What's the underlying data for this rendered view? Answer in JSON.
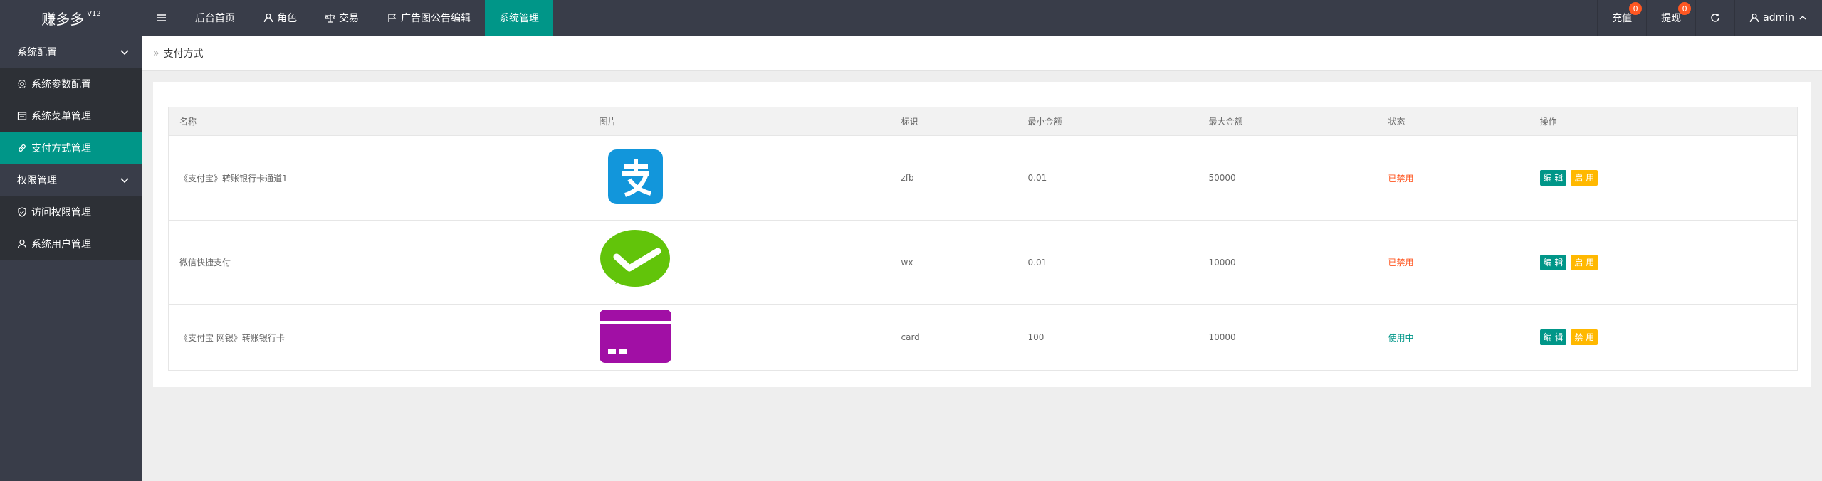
{
  "header": {
    "logo": "赚多多",
    "version": "V12",
    "nav": [
      {
        "label": "",
        "icon": "menu-icon"
      },
      {
        "label": "后台首页"
      },
      {
        "label": "角色",
        "icon": "user-icon"
      },
      {
        "label": "交易",
        "icon": "scale-icon"
      },
      {
        "label": "广告图公告编辑",
        "icon": "flag-icon"
      },
      {
        "label": "系统管理",
        "active": true
      }
    ],
    "right": {
      "recharge_label": "充值",
      "recharge_count": "0",
      "withdraw_label": "提现",
      "withdraw_count": "0",
      "user_label": "admin"
    }
  },
  "sidebar": {
    "groups": [
      {
        "label": "系统配置",
        "items": [
          {
            "label": "系统参数配置",
            "icon": "gear-icon"
          },
          {
            "label": "系统菜单管理",
            "icon": "list-icon"
          },
          {
            "label": "支付方式管理",
            "icon": "link-icon",
            "active": true
          }
        ]
      },
      {
        "label": "权限管理",
        "items": [
          {
            "label": "访问权限管理",
            "icon": "shield-icon"
          },
          {
            "label": "系统用户管理",
            "icon": "user-icon"
          }
        ]
      }
    ]
  },
  "breadcrumb": {
    "current": "支付方式"
  },
  "table": {
    "headers": [
      "名称",
      "图片",
      "标识",
      "最小金额",
      "最大金额",
      "状态",
      "操作"
    ],
    "rows": [
      {
        "name": "《支付宝》转账银行卡通道1",
        "image": "alipay-logo",
        "id": "zfb",
        "min": "0.01",
        "max": "50000",
        "status": "已禁用",
        "status_state": "disabled",
        "edit": "编 辑",
        "toggle": "启 用"
      },
      {
        "name": "微信快捷支付",
        "image": "wechat-logo",
        "id": "wx",
        "min": "0.01",
        "max": "10000",
        "status": "已禁用",
        "status_state": "disabled",
        "edit": "编 辑",
        "toggle": "启 用"
      },
      {
        "name": "《支付宝 网银》转账银行卡",
        "image": "bankcard-logo",
        "id": "card",
        "min": "100",
        "max": "10000",
        "status": "使用中",
        "status_state": "active",
        "edit": "编 辑",
        "toggle": "禁 用"
      }
    ]
  },
  "colors": {
    "header_bg": "#393d49",
    "accent": "#009688",
    "warn": "#ffb800",
    "danger": "#ff5722",
    "alipay": "#1296db",
    "wechat": "#62c40a",
    "bankcard": "#a10fa5"
  }
}
